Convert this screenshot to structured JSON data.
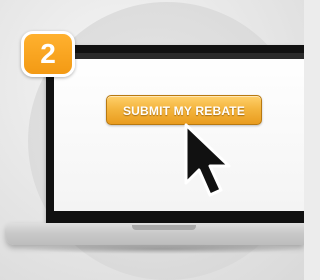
{
  "step": {
    "number": "2"
  },
  "screen": {
    "button_label": "SUBMIT MY REBATE"
  },
  "colors": {
    "badge": "#f39a14",
    "button": "#f4b63f",
    "laptop_bezel": "#111111",
    "background": "#e6e6e6"
  },
  "icons": {
    "cursor": "arrow-cursor-icon",
    "device": "laptop-icon"
  }
}
